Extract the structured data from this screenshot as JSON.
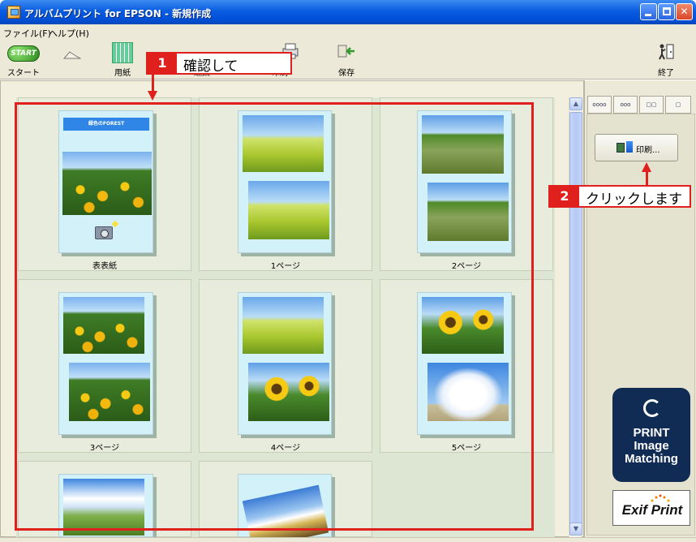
{
  "window": {
    "title": "アルバムプリント for EPSON - 新規作成",
    "buttons": {
      "minimize": "",
      "maximize": "",
      "close": "✕"
    }
  },
  "menu": {
    "items": [
      "ファイル(F)",
      "ヘルプ(H)"
    ]
  },
  "toolbar": {
    "start_label": "スタート",
    "start_icon_text": "START",
    "paper_label": "用紙",
    "edit_label": "編集",
    "print_label": "印刷",
    "save_label": "保存",
    "exit_label": "終了"
  },
  "pages": [
    {
      "label": "表表紙",
      "banner": "緑色のFOREST"
    },
    {
      "label": "1ページ"
    },
    {
      "label": "2ページ"
    },
    {
      "label": "3ページ"
    },
    {
      "label": "4ページ"
    },
    {
      "label": "5ページ"
    }
  ],
  "scrollbar": {
    "up": "▲",
    "down": "▼"
  },
  "right_panel": {
    "tabs": [
      "oooo",
      "ooo",
      "▢▢",
      "▢"
    ],
    "print_button_label": "印刷..."
  },
  "logos": {
    "pim_lines": [
      "PRINT",
      "Image",
      "Matching"
    ],
    "exif_text": "Exif Print"
  },
  "annotations": {
    "step1": {
      "number": "1",
      "text": "確認して"
    },
    "step2": {
      "number": "2",
      "text": "クリックします"
    }
  },
  "colors": {
    "annotation_red": "#e0201c",
    "title_blue": "#0a5ce0",
    "page_background": "#d3f1f8"
  }
}
